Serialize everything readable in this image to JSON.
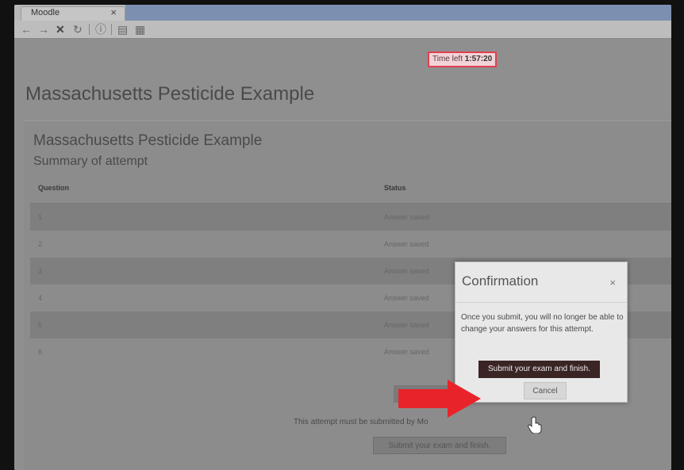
{
  "browser": {
    "tab_title": "Moodle",
    "tab_close": "×",
    "nav": {
      "back": "←",
      "forward": "→",
      "stop": "✕",
      "reload": "↻",
      "info": "ⓘ",
      "reader": "▤",
      "calc": "▦"
    }
  },
  "timer": {
    "label": "Time left",
    "value": "1:57:20"
  },
  "page": {
    "heading": "Massachusetts Pesticide Example"
  },
  "summary": {
    "title": "Massachusetts Pesticide Example",
    "subtitle": "Summary of attempt",
    "columns": [
      "Question",
      "Status"
    ],
    "rows": [
      {
        "question": "1",
        "status": "Answer saved"
      },
      {
        "question": "2",
        "status": "Answer saved"
      },
      {
        "question": "3",
        "status": "Answer saved"
      },
      {
        "question": "4",
        "status": "Answer saved"
      },
      {
        "question": "5",
        "status": "Answer saved"
      },
      {
        "question": "6",
        "status": "Answer saved"
      }
    ]
  },
  "footer": {
    "note": "This attempt must be submitted by Mo",
    "submit_label": "Submit your exam and finish."
  },
  "modal": {
    "title": "Confirmation",
    "close": "×",
    "body": "Once you submit, you will no longer be able to change your answers for this attempt.",
    "submit_label": "Submit your exam and finish.",
    "cancel_label": "Cancel"
  },
  "colors": {
    "timer_border": "#e04050",
    "arrow": "#e8242a",
    "primary_button": "#3a2424"
  }
}
